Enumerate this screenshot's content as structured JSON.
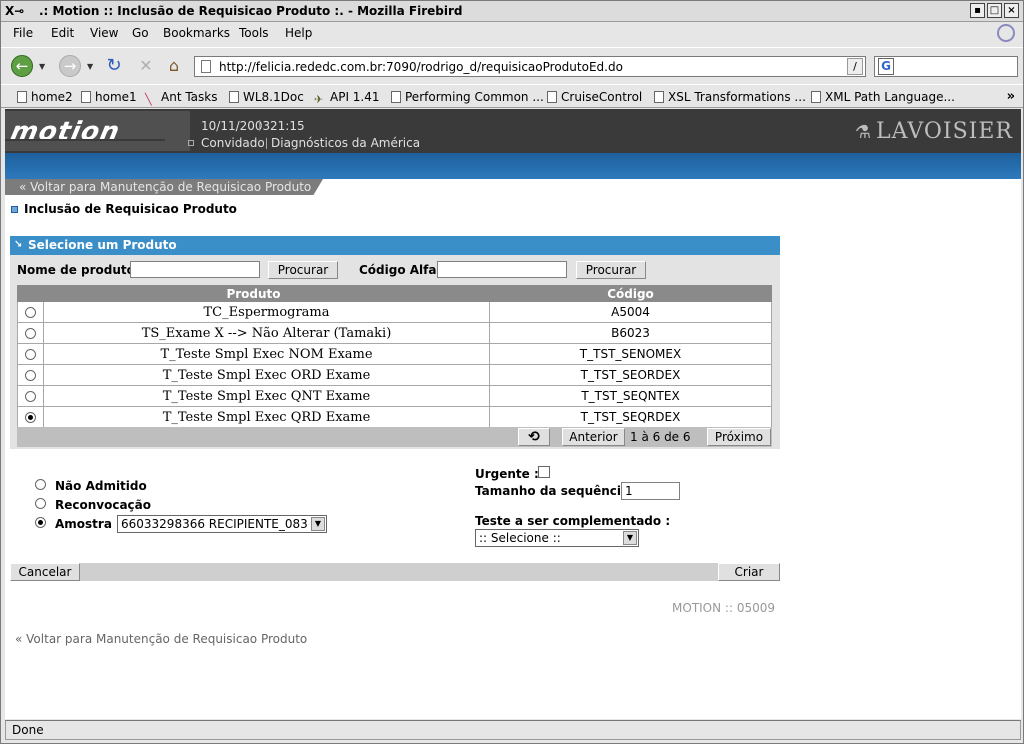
{
  "window": {
    "title": ".: Motion :: Inclusão de Requisicao Produto :. - Mozilla Firebird",
    "controls": [
      "▪",
      "□",
      "×"
    ]
  },
  "menu": [
    "File",
    "Edit",
    "View",
    "Go",
    "Bookmarks",
    "Tools",
    "Help"
  ],
  "nav": {
    "url": "http://felicia.rededc.com.br:7090/rodrigo_d/requisicaoProdutoEd.do",
    "search_value": ""
  },
  "bookmarks": [
    "home2",
    "home1",
    "Ant Tasks",
    "WL8.1Doc",
    "API 1.41",
    "Performing Common ...",
    "CruiseControl",
    "XSL Transformations ...",
    "XML Path Language..."
  ],
  "header": {
    "date": "10/11/2003",
    "time": "21:15",
    "user": "Convidado",
    "org": "Diagnósticos da América",
    "brand": "LAVOISIER",
    "logo": "motion"
  },
  "back_link": "Voltar para Manutenção de Requisicao Produto",
  "page_title": "Inclusão de Requisicao Produto",
  "select_panel": {
    "title": "Selecione um Produto",
    "nome_label": "Nome de produto :",
    "nome_value": "",
    "codigo_label": "Código Alfa :",
    "codigo_value": "",
    "search_button": "Procurar",
    "columns": [
      "Produto",
      "Código"
    ],
    "rows": [
      {
        "produto": "TC_Espermograma",
        "codigo": "A5004",
        "selected": false
      },
      {
        "produto": "TS_Exame X --> Não Alterar (Tamaki)",
        "codigo": "B6023",
        "selected": false
      },
      {
        "produto": "T_Teste Smpl Exec NOM Exame",
        "codigo": "T_TST_SENOMEX",
        "selected": false
      },
      {
        "produto": "T_Teste Smpl Exec ORD Exame",
        "codigo": "T_TST_SEORDEX",
        "selected": false
      },
      {
        "produto": "T_Teste Smpl Exec QNT Exame",
        "codigo": "T_TST_SEQNTEX",
        "selected": false
      },
      {
        "produto": "T_Teste Smpl Exec QRD Exame",
        "codigo": "T_TST_SEQRDEX",
        "selected": true
      }
    ],
    "pager": {
      "prev": "Anterior",
      "counter": "1 à 6 de 6",
      "next": "Próximo"
    }
  },
  "form": {
    "nao_admitido": "Não Admitido",
    "reconvocacao": "Reconvocação",
    "amostra": "Amostra :",
    "amostra_value": "66033298366 RECIPIENTE_083",
    "urgente": "Urgente :",
    "tamanho": "Tamanho da sequência :",
    "tamanho_value": "1",
    "teste": "Teste a ser complementado :",
    "teste_value": ":: Selecione ::"
  },
  "actions": {
    "cancel": "Cancelar",
    "create": "Criar"
  },
  "footer_code": "MOTION :: 05009",
  "status": "Done"
}
